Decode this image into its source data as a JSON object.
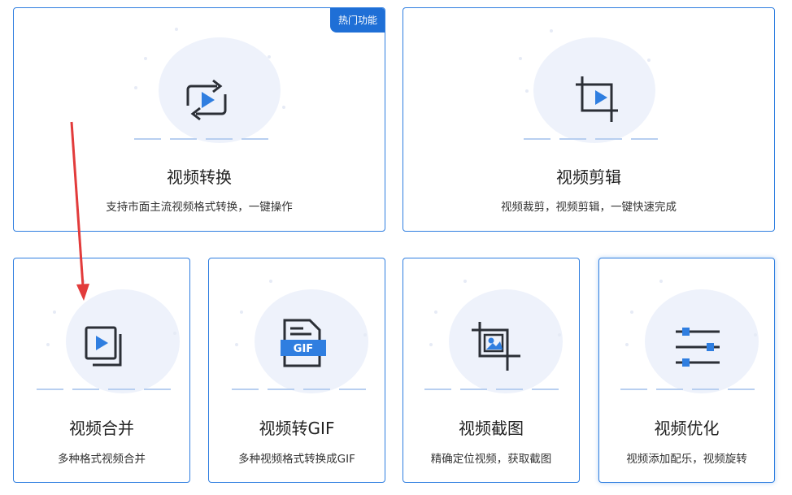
{
  "colors": {
    "accent": "#2f7ee0",
    "badge": "#1f6fd6",
    "icon_dark": "#2b2f36",
    "arrow": "#e23b3b"
  },
  "cards": [
    {
      "title": "视频转换",
      "desc": "支持市面主流视频格式转换，一键操作",
      "badge": "热门功能",
      "icon": "convert-icon"
    },
    {
      "title": "视频剪辑",
      "desc": "视频裁剪，视频剪辑，一键快速完成",
      "icon": "crop-icon"
    },
    {
      "title": "视频合并",
      "desc": "多种格式视频合并",
      "icon": "merge-icon"
    },
    {
      "title": "视频转GIF",
      "desc": "多种视频格式转换成GIF",
      "icon": "gif-file-icon",
      "icon_label": "GIF"
    },
    {
      "title": "视频截图",
      "desc": "精确定位视频，获取截图",
      "icon": "screenshot-icon"
    },
    {
      "title": "视频优化",
      "desc": "视频添加配乐，视频旋转",
      "icon": "sliders-icon"
    }
  ]
}
